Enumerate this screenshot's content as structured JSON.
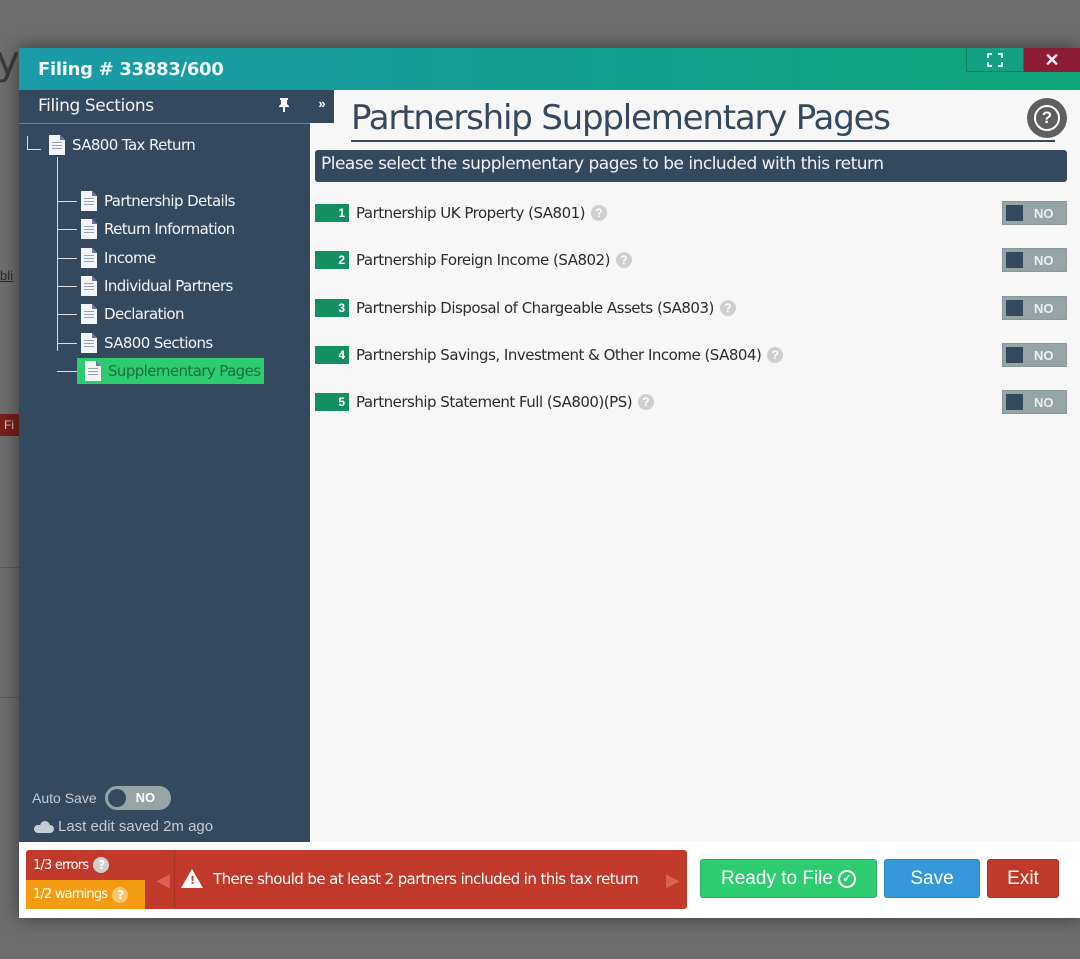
{
  "background": {
    "title_fragment": "y",
    "link_fragment": "bli",
    "badge_fragment": "Fi"
  },
  "window": {
    "title": "Filing # 33883/600",
    "maximize_icon": "expand-icon",
    "close_icon": "close-icon",
    "close_glyph": "✕"
  },
  "sidebar": {
    "header": "Filing Sections",
    "pin_glyph": "📌",
    "collapse_glyph": "»",
    "root": {
      "label": "SA800 Tax Return",
      "icon": "document-icon"
    },
    "items": [
      {
        "label": "Partnership Details",
        "icon": "document-icon",
        "active": false
      },
      {
        "label": "Return Information",
        "icon": "document-icon",
        "active": false
      },
      {
        "label": "Income",
        "icon": "document-icon",
        "active": false
      },
      {
        "label": "Individual Partners",
        "icon": "document-icon",
        "active": false
      },
      {
        "label": "Declaration",
        "icon": "document-icon",
        "active": false
      },
      {
        "label": "SA800 Sections",
        "icon": "document-icon",
        "active": false
      },
      {
        "label": "Supplementary Pages",
        "icon": "document-icon",
        "active": true
      }
    ],
    "autosave": {
      "label": "Auto Save",
      "state": "NO"
    },
    "last_saved": "Last edit saved 2m ago"
  },
  "main": {
    "title": "Partnership Supplementary Pages",
    "help_glyph": "?",
    "instruction": "Please select the supplementary pages to be included with this return",
    "pages": [
      {
        "number": "1",
        "name": "Partnership UK Property (SA801)",
        "toggle": "NO"
      },
      {
        "number": "2",
        "name": "Partnership Foreign Income (SA802)",
        "toggle": "NO"
      },
      {
        "number": "3",
        "name": "Partnership Disposal of Chargeable Assets (SA803)",
        "toggle": "NO"
      },
      {
        "number": "4",
        "name": "Partnership Savings, Investment & Other Income (SA804)",
        "toggle": "NO"
      },
      {
        "number": "5",
        "name": "Partnership Statement Full (SA800)(PS)",
        "toggle": "NO"
      }
    ],
    "info_glyph": "?"
  },
  "footer": {
    "errors": "1/3 errors",
    "warnings": "1/2 warnings",
    "prev_glyph": "◀",
    "next_glyph": "▶",
    "message": "There should be at least 2 partners included in this tax return",
    "ready_label": "Ready to File",
    "ready_glyph": "✓",
    "save_label": "Save",
    "exit_label": "Exit"
  },
  "colors": {
    "sidebar_bg": "#34495e",
    "accent_green": "#2ecc71",
    "number_badge": "#148f5f",
    "error_red": "#c0392b",
    "warning_orange": "#f39c12",
    "save_blue": "#3498db"
  }
}
